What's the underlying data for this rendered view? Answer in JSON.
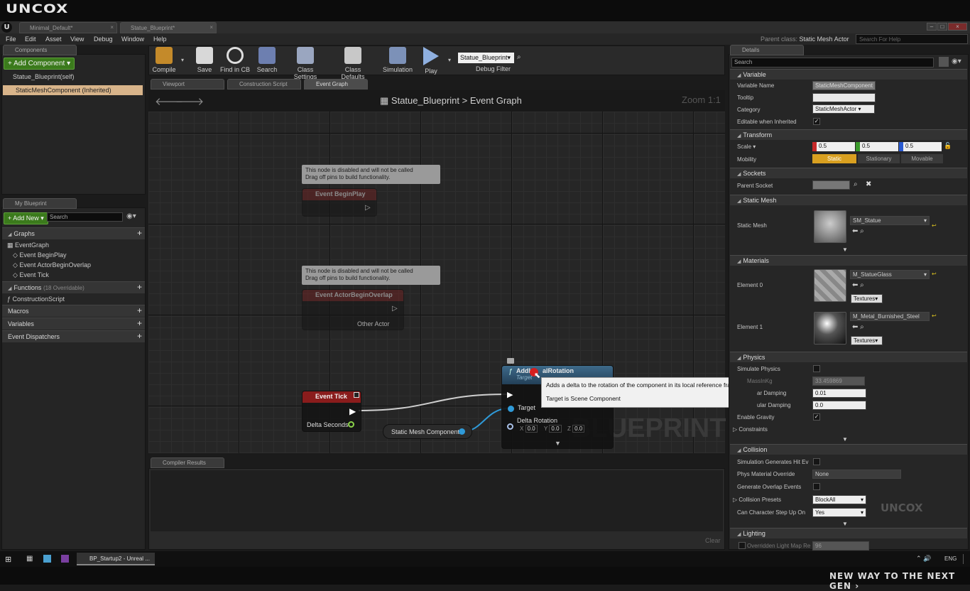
{
  "brand": {
    "logo": "UNCOX",
    "tagline": "NEW WAY TO THE NEXT GEN ›"
  },
  "doc_tabs": [
    {
      "label": "Minimal_Default*"
    },
    {
      "label": "Statue_Blueprint*"
    }
  ],
  "parent_class": {
    "label": "Parent class:",
    "value": "Static Mesh Actor"
  },
  "help_search": {
    "placeholder": "Search For Help"
  },
  "menu": [
    "File",
    "Edit",
    "Asset",
    "View",
    "Debug",
    "Window",
    "Help"
  ],
  "components": {
    "tab": "Components",
    "add_label": "+ Add Component ▾",
    "items": [
      "Statue_Blueprint(self)",
      "StaticMeshComponent (Inherited)"
    ]
  },
  "toolbar": {
    "buttons": [
      "Compile",
      "Save",
      "Find in CB",
      "Search",
      "Class Settings",
      "Class Defaults",
      "Simulation",
      "Play"
    ],
    "debug_select": "Statue_Blueprint▾",
    "debug_label": "Debug Filter"
  },
  "editor_tabs": [
    "Viewport",
    "Construction Script",
    "Event Graph"
  ],
  "breadcrumb": {
    "root": "Statue_Blueprint",
    "sep": ">",
    "leaf": "Event Graph"
  },
  "zoom": "Zoom 1:1",
  "my_blueprint": {
    "tab": "My Blueprint",
    "add_label": "+ Add New ▾",
    "search_placeholder": "Search",
    "graphs": {
      "title": "Graphs",
      "items": [
        "EventGraph",
        "Event BeginPlay",
        "Event ActorBeginOverlap",
        "Event Tick"
      ]
    },
    "functions": {
      "title": "Functions",
      "sub": "(18 Overridable)",
      "items": [
        "ConstructionScript"
      ]
    },
    "macros": "Macros",
    "variables": "Variables",
    "dispatchers": "Event Dispatchers"
  },
  "nodes": {
    "comment1": [
      "This node is disabled and will not be called",
      "Drag off pins to build functionality."
    ],
    "comment2": [
      "This node is disabled and will not be called",
      "Drag off pins to build functionality."
    ],
    "begin_play": "Event BeginPlay",
    "overlap": "Event ActorBeginOverlap",
    "other_actor": "Other Actor",
    "tick": "Event Tick",
    "delta_seconds": "Delta Seconds",
    "static_mesh_comp": "Static Mesh Component",
    "add_rot_title": "AddL",
    "add_rot_title2": "alRotation",
    "add_rot_sub": "Target",
    "target": "Target",
    "delta_rotation": "Delta Rotation",
    "rot_x": "0.0",
    "rot_y": "0.0",
    "rot_z": "0.0"
  },
  "tooltip": [
    "Adds a delta to the rotation of the component in its local reference frame",
    "Target is Scene Component"
  ],
  "watermark": "BLUEPRINT",
  "compiler": {
    "tab": "Compiler Results",
    "clear": "Clear"
  },
  "details": {
    "tab": "Details",
    "search_placeholder": "Search",
    "variable": {
      "title": "Variable",
      "name_label": "Variable Name",
      "name_value": "StaticMeshComponent",
      "tooltip_label": "Tooltip",
      "category_label": "Category",
      "category_value": "StaticMeshActor",
      "editable_label": "Editable when Inherited"
    },
    "transform": {
      "title": "Transform",
      "scale_label": "Scale ▾",
      "x": "0.5",
      "y": "0.5",
      "z": "0.5",
      "mobility_label": "Mobility",
      "mobility": [
        "Static",
        "Stationary",
        "Movable"
      ]
    },
    "sockets": {
      "title": "Sockets",
      "parent_label": "Parent Socket"
    },
    "static_mesh": {
      "title": "Static Mesh",
      "label": "Static Mesh",
      "value": "SM_Statue"
    },
    "materials": {
      "title": "Materials",
      "e0_label": "Element 0",
      "e0_value": "M_StatueGlass",
      "e1_label": "Element 1",
      "e1_value": "M_Metal_Burnished_Steel",
      "textures": "Textures"
    },
    "physics": {
      "title": "Physics",
      "simulate": "Simulate Physics",
      "mass_label": "MassInKg",
      "mass": "33.459869",
      "linear_label": "ar Damping",
      "linear": "0.01",
      "angular_label": "ular Damping",
      "angular": "0.0",
      "gravity": "Enable Gravity",
      "constraints": "Constraints"
    },
    "collision": {
      "title": "Collision",
      "sim_hit": "Simulation Generates Hit Ev",
      "phys_mat": "Phys Material Override",
      "phys_mat_value": "None",
      "overlap": "Generate Overlap Events",
      "presets": "Collision Presets",
      "presets_value": "BlockAll",
      "step": "Can Character Step Up On",
      "step_value": "Yes"
    },
    "lighting": {
      "title": "Lighting",
      "override": "Overridden Light Map Re",
      "override_value": "96"
    }
  },
  "taskbar": {
    "app": "BP_Startup2 - Unreal ...",
    "lang": "ENG"
  },
  "colors": {
    "accent_green": "#3b7a1c",
    "tick_red": "#8a1c1c",
    "func_blue": "#2d5a7a",
    "static_orange": "#d9a020"
  }
}
